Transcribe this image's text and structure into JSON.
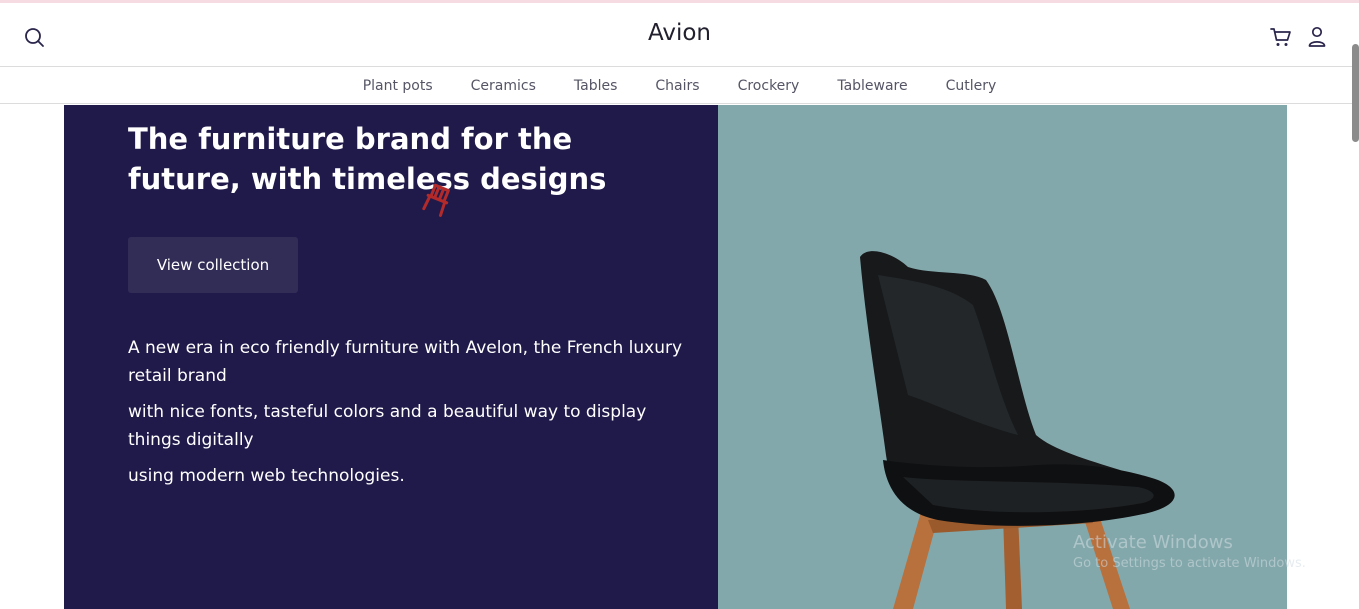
{
  "header": {
    "brand": "Avion",
    "icons": {
      "search": "search-icon",
      "cart": "cart-icon",
      "user": "user-icon"
    }
  },
  "nav": {
    "items": [
      {
        "label": "Plant pots"
      },
      {
        "label": "Ceramics"
      },
      {
        "label": "Tables"
      },
      {
        "label": "Chairs"
      },
      {
        "label": "Crockery"
      },
      {
        "label": "Tableware"
      },
      {
        "label": "Cutlery"
      }
    ]
  },
  "hero": {
    "title": "The furniture brand for the future, with timeless designs",
    "cta_label": "View collection",
    "description": [
      "A new era in eco friendly furniture with Avelon, the French luxury retail brand",
      "with nice fonts, tasteful colors and a beautiful way to display things digitally",
      "using modern web technologies."
    ],
    "image": "chair-image",
    "cursor": "chair-cursor-icon"
  },
  "watermark": {
    "title": "Activate Windows",
    "subtitle": "Go to Settings to activate Windows."
  },
  "colors": {
    "hero_dark": "#201a4a",
    "hero_image_bg": "#83a8ab",
    "button_bg": "#322d57",
    "top_accent": "#f7dbe2"
  }
}
